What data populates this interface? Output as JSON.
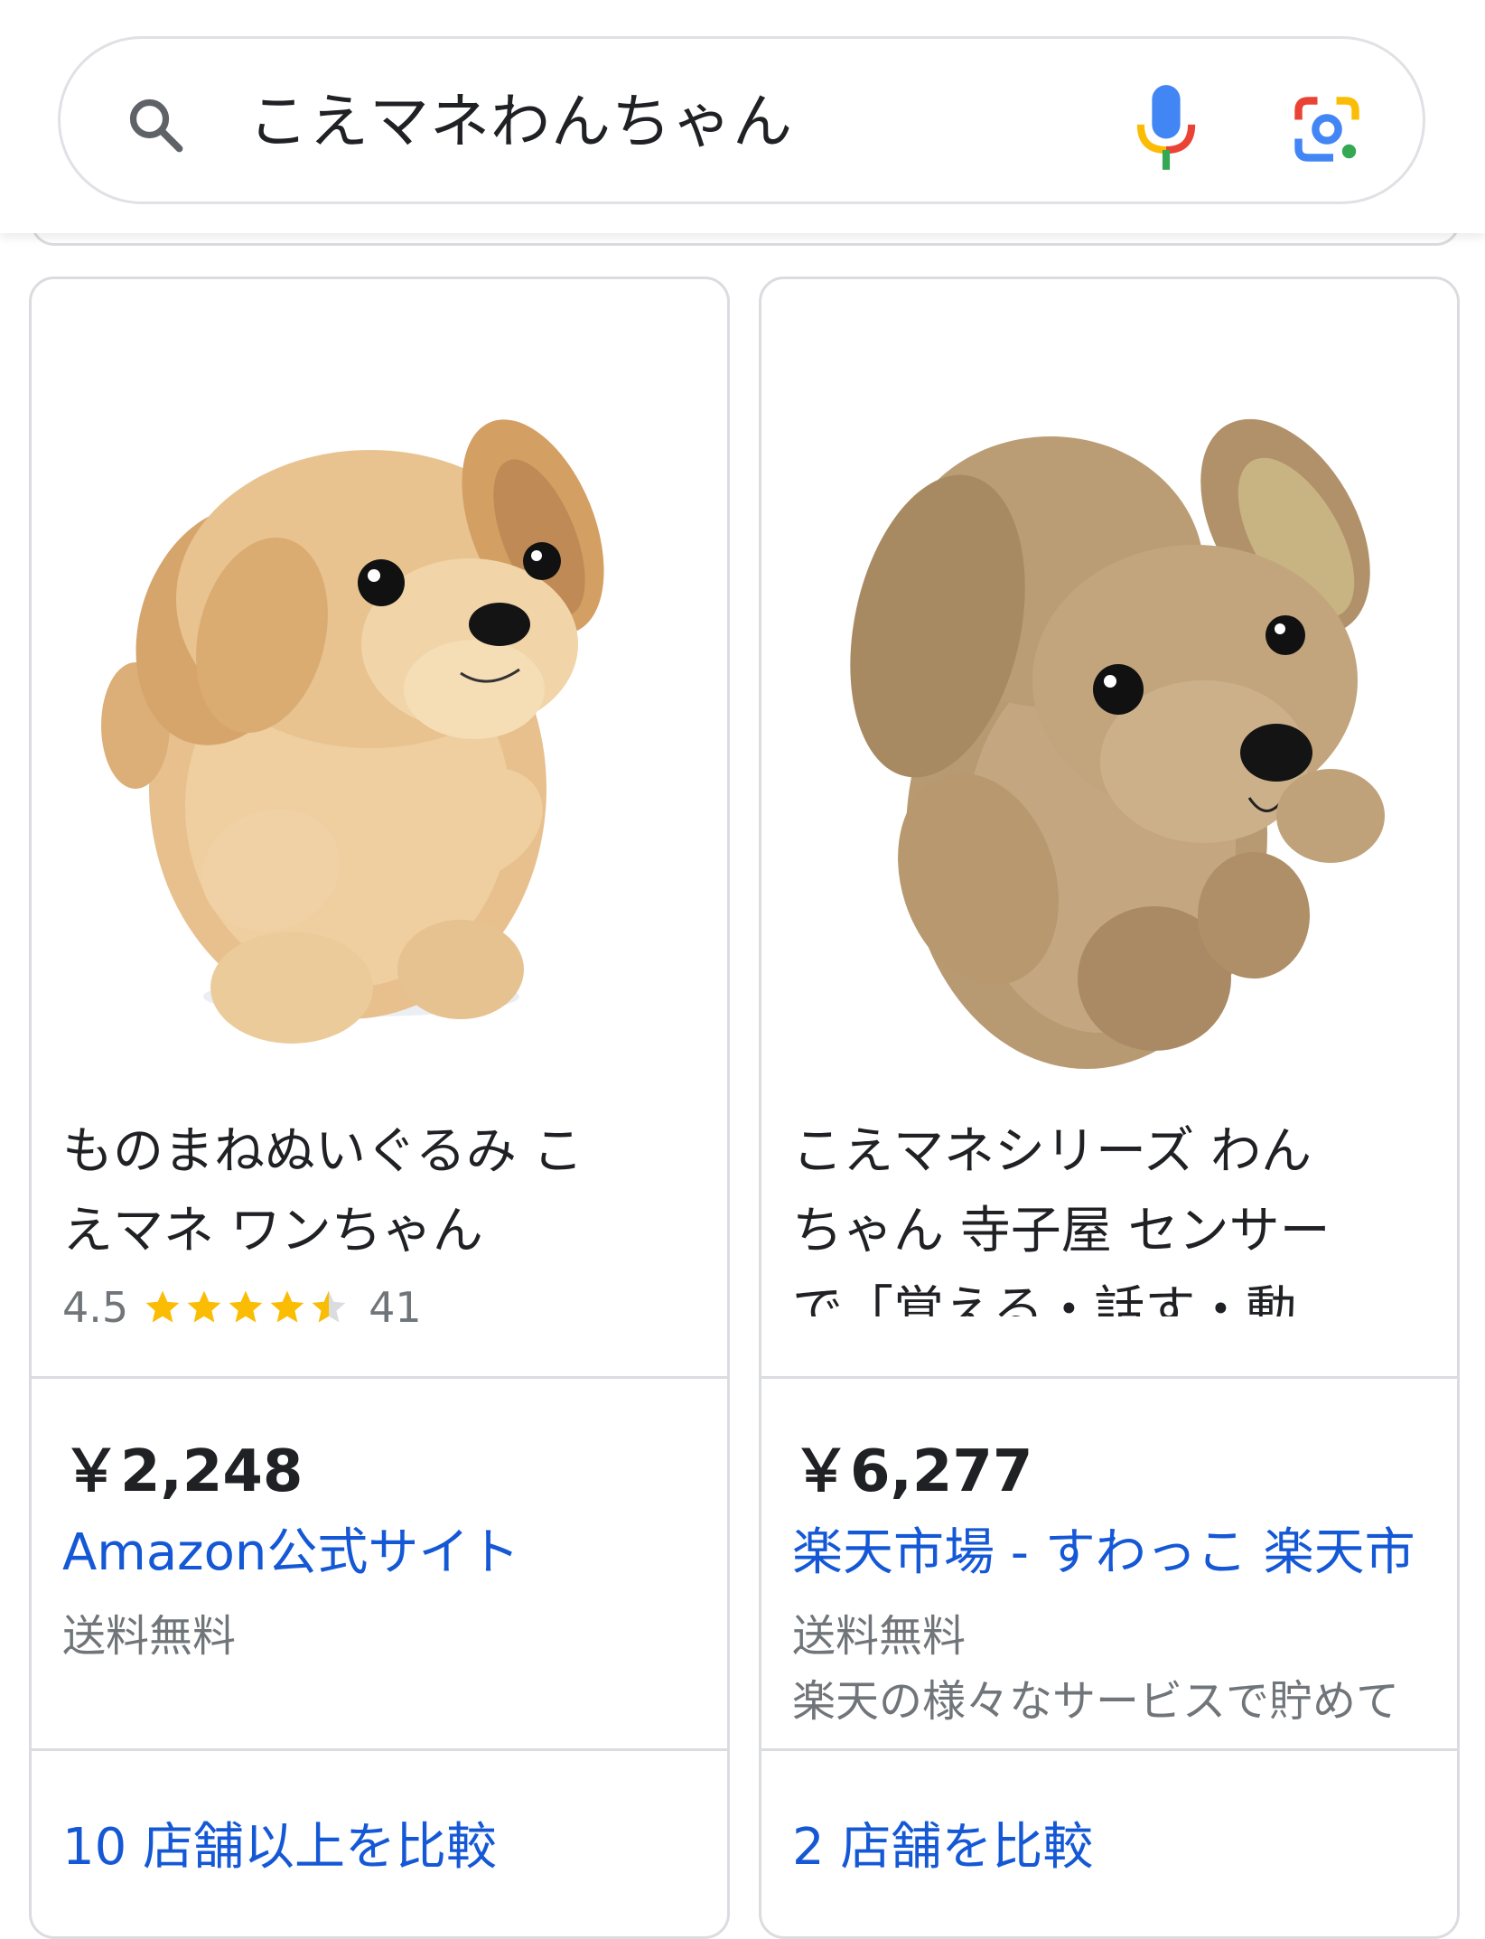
{
  "search": {
    "query": "こえマネわんちゃん"
  },
  "colors": {
    "link_blue": "#1558d6",
    "star_gold": "#fbbc04",
    "text_dark": "#202124",
    "text_gray": "#70757a",
    "border": "#dadce0"
  },
  "products": [
    {
      "title_lines": [
        "ものまねぬいぐるみ こ",
        "えマネ ワンちゃん"
      ],
      "image": "tan plush puppy toy",
      "rating": "4.5",
      "rating_value": 4.5,
      "review_count": "41",
      "price": "￥2,248",
      "seller": "Amazon公式サイト",
      "shipping": "送料無料",
      "compare": "10 店舗以上を比較"
    },
    {
      "title_lines": [
        "こえマネシリーズ わん",
        "ちゃん 寺子屋 センサー",
        "で「覚える・話す・動"
      ],
      "image": "brown plush puppy toy",
      "price": "￥6,277",
      "seller": "楽天市場 - すわっこ 楽天市",
      "shipping": "送料無料",
      "extra": "楽天の様々なサービスで貯めて",
      "compare": "2 店舗を比較"
    }
  ]
}
